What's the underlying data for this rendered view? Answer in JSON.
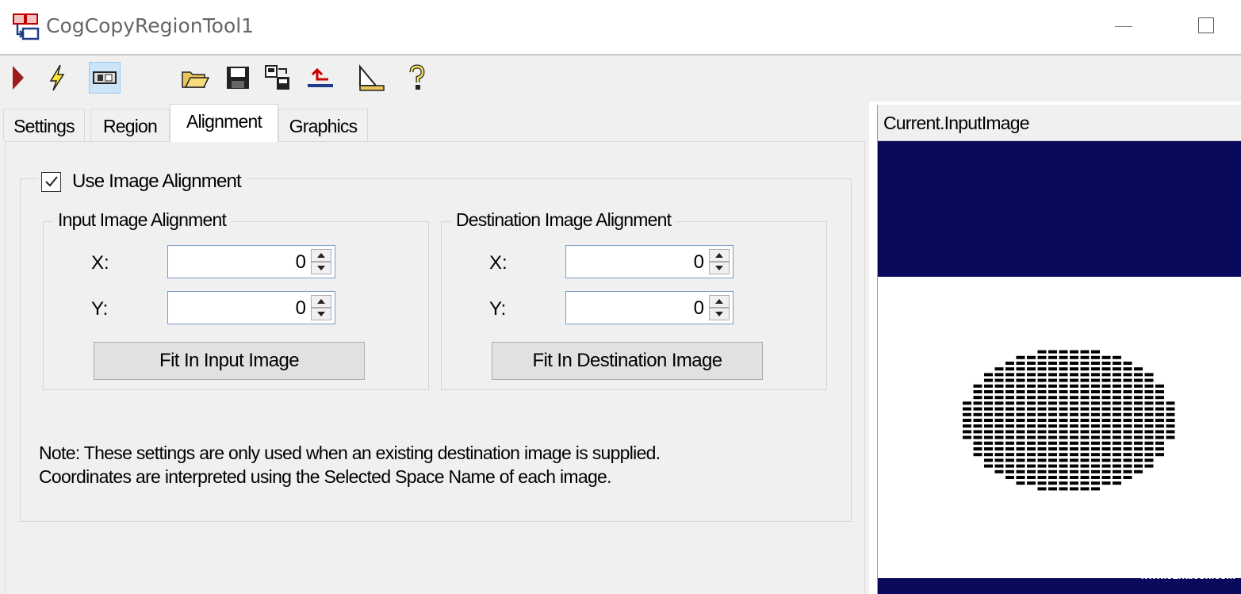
{
  "window": {
    "title": "CogCopyRegionTool1"
  },
  "toolbar": {
    "buttons": [
      {
        "icon": "run-arrow-icon"
      },
      {
        "icon": "lightning-icon"
      },
      {
        "icon": "image-display-icon",
        "pressed": true
      },
      {
        "icon": "open-folder-icon"
      },
      {
        "icon": "save-icon"
      },
      {
        "icon": "copy-settings-icon"
      },
      {
        "icon": "load-upload-icon"
      },
      {
        "icon": "triangle-measure-icon"
      },
      {
        "icon": "help-icon"
      }
    ]
  },
  "tabs": [
    {
      "label": "Settings",
      "active": false
    },
    {
      "label": "Region",
      "active": false
    },
    {
      "label": "Alignment",
      "active": true
    },
    {
      "label": "Graphics",
      "active": false
    }
  ],
  "alignment": {
    "use_image_alignment": {
      "label": "Use Image Alignment",
      "checked": true
    },
    "input_group": {
      "title": "Input Image Alignment",
      "x_label": "X:",
      "x_value": "0",
      "y_label": "Y:",
      "y_value": "0",
      "button": "Fit In Input Image"
    },
    "dest_group": {
      "title": "Destination Image Alignment",
      "x_label": "X:",
      "x_value": "0",
      "y_label": "Y:",
      "y_value": "0",
      "button": "Fit In Destination Image"
    },
    "note_line1": "Note: These settings are only used when an existing destination image is supplied.",
    "note_line2": "Coordinates are interpreted using the Selected Space Name of each image."
  },
  "image_panel": {
    "header": "Current.InputImage",
    "watermark": "www.51halcon.com",
    "colors": {
      "band": "#0a0a5c",
      "die": "#000000"
    }
  }
}
